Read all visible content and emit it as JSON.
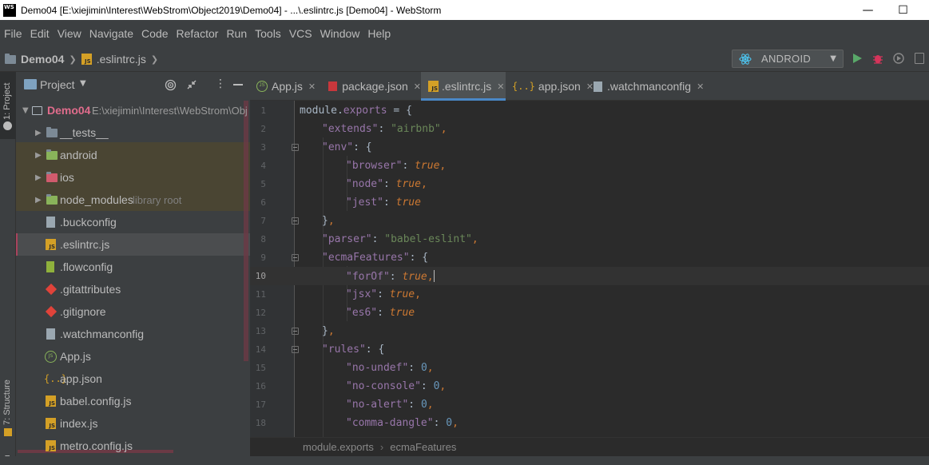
{
  "window": {
    "title": "Demo04 [E:\\xiejimin\\Interest\\WebStrom\\Object2019\\Demo04] - ...\\.eslintrc.js [Demo04] - WebStorm",
    "logo": "WS",
    "minimize": "—",
    "maximize": "☐"
  },
  "menu": [
    "File",
    "Edit",
    "View",
    "Navigate",
    "Code",
    "Refactor",
    "Run",
    "Tools",
    "VCS",
    "Window",
    "Help"
  ],
  "navbar": {
    "project": "Demo04",
    "file": ".eslintrc.js"
  },
  "run_config": {
    "label": "ANDROID",
    "accent": "#4ec9f5"
  },
  "left_stripe": {
    "project_tab": "1: Project",
    "structure_tab": "7: Structure",
    "bottom_tab": "rm"
  },
  "project_panel": {
    "title": "Project",
    "tree": [
      {
        "label": "Demo04",
        "hint": "E:\\xiejimin\\Interest\\WebStrom\\Obj",
        "type": "root"
      },
      {
        "label": "__tests__",
        "type": "folder"
      },
      {
        "label": "android",
        "type": "folder-android"
      },
      {
        "label": "ios",
        "type": "folder-ios"
      },
      {
        "label": "node_modules",
        "hint": "library root",
        "type": "folder-lib"
      },
      {
        "label": ".buckconfig",
        "type": "file"
      },
      {
        "label": ".eslintrc.js",
        "type": "js"
      },
      {
        "label": ".flowconfig",
        "type": "flow"
      },
      {
        "label": ".gitattributes",
        "type": "git"
      },
      {
        "label": ".gitignore",
        "type": "git"
      },
      {
        "label": ".watchmanconfig",
        "type": "file"
      },
      {
        "label": "App.js",
        "type": "jsx"
      },
      {
        "label": "app.json",
        "type": "json"
      },
      {
        "label": "babel.config.js",
        "type": "js"
      },
      {
        "label": "index.js",
        "type": "js"
      },
      {
        "label": "metro.config.js",
        "type": "js"
      }
    ]
  },
  "tabs": [
    {
      "label": "App.js",
      "icon": "react-js-icon"
    },
    {
      "label": "package.json",
      "icon": "npm-icon"
    },
    {
      "label": ".eslintrc.js",
      "icon": "js-file-icon",
      "active": true
    },
    {
      "label": "app.json",
      "icon": "json-icon"
    },
    {
      "label": ".watchmanconfig",
      "icon": "text-file-icon"
    }
  ],
  "editor": {
    "current_line": 10,
    "lines": [
      {
        "n": "1",
        "t": "module.exports = {"
      },
      {
        "n": "2",
        "t": "\"extends\": \"airbnb\","
      },
      {
        "n": "3",
        "t": "\"env\": {"
      },
      {
        "n": "4",
        "t": "\"browser\": true,"
      },
      {
        "n": "5",
        "t": "\"node\": true,"
      },
      {
        "n": "6",
        "t": "\"jest\": true"
      },
      {
        "n": "7",
        "t": "},"
      },
      {
        "n": "8",
        "t": "\"parser\": \"babel-eslint\","
      },
      {
        "n": "9",
        "t": "\"ecmaFeatures\": {"
      },
      {
        "n": "10",
        "t": "\"forOf\": true,"
      },
      {
        "n": "11",
        "t": "\"jsx\": true,"
      },
      {
        "n": "12",
        "t": "\"es6\": true"
      },
      {
        "n": "13",
        "t": "},"
      },
      {
        "n": "14",
        "t": "\"rules\": {"
      },
      {
        "n": "15",
        "t": "\"no-undef\": 0,"
      },
      {
        "n": "16",
        "t": "\"no-console\": 0,"
      },
      {
        "n": "17",
        "t": "\"no-alert\": 0,"
      },
      {
        "n": "18",
        "t": "\"comma-dangle\": 0,"
      }
    ]
  },
  "breadcrumbs": [
    "module.exports",
    "ecmaFeatures"
  ]
}
